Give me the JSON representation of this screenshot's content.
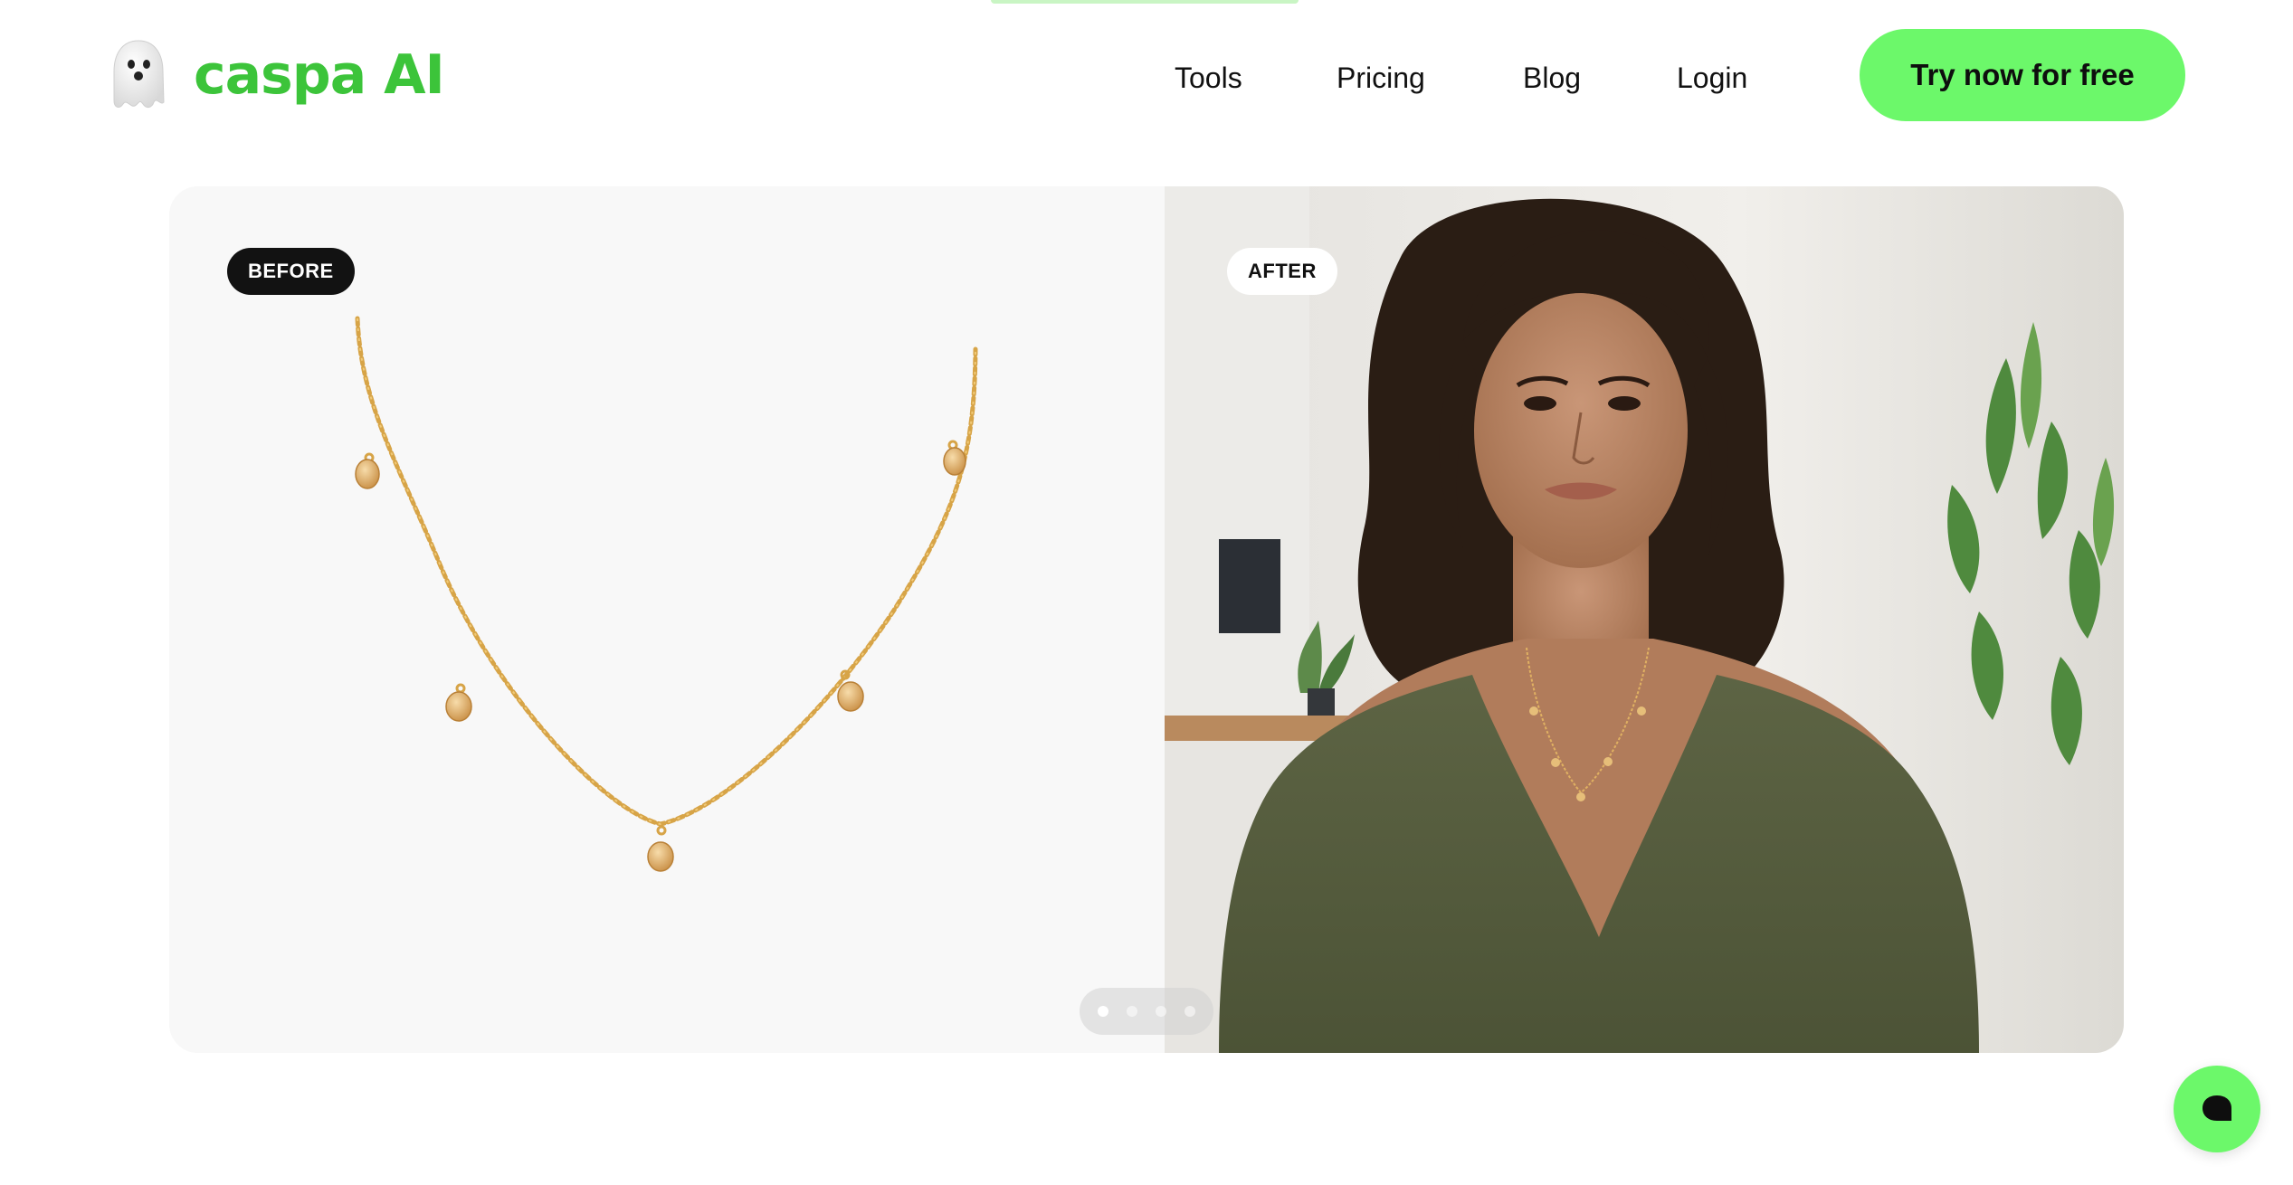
{
  "brand": {
    "name": "caspa AI",
    "color": "#3cc43a",
    "logo_icon": "ghost-icon"
  },
  "nav": {
    "tools": "Tools",
    "pricing": "Pricing",
    "blog": "Blog",
    "login": "Login"
  },
  "cta": {
    "label": "Try now for free",
    "color": "#6cf86a"
  },
  "comparison": {
    "before_label": "BEFORE",
    "after_label": "AFTER",
    "before_image": "gold-chain-necklace-with-pendants",
    "after_image": "model-wearing-necklace",
    "slides_total": 4,
    "active_slide": 1
  },
  "chat_widget": {
    "icon": "chat-bubble-icon"
  }
}
